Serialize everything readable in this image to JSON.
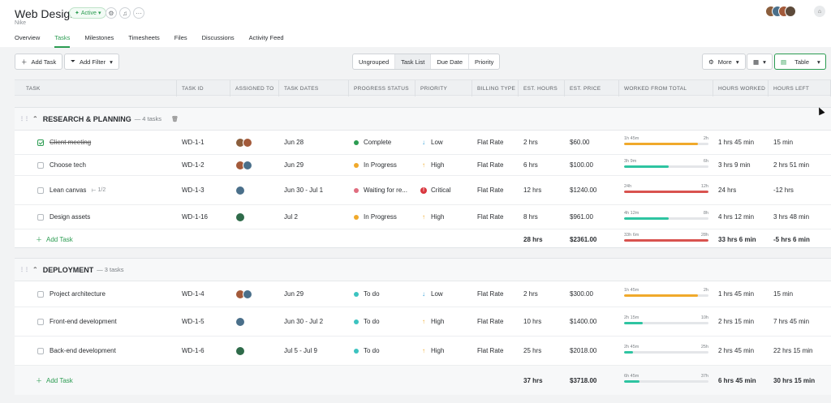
{
  "project": {
    "title": "Web Design",
    "subtitle": "Nike",
    "status": "Active",
    "status_icon": "sparkle-icon"
  },
  "tabs": [
    "Overview",
    "Tasks",
    "Milestones",
    "Timesheets",
    "Files",
    "Discussions",
    "Activity Feed"
  ],
  "active_tab": "Tasks",
  "toolbar": {
    "add_task": "Add Task",
    "add_filter": "Add Filter",
    "view_modes": [
      "Ungrouped",
      "Task List",
      "Due Date",
      "Priority"
    ],
    "selected_view_mode": "Task List",
    "more": "More",
    "view_type": "Table"
  },
  "columns": [
    "TASK",
    "TASK ID",
    "ASSIGNED TO",
    "TASK DATES",
    "PROGRESS STATUS",
    "PRIORITY",
    "BILLING TYPE",
    "EST. HOURS",
    "EST. PRICE",
    "WORKED FROM TOTAL",
    "HOURS WORKED",
    "HOURS LEFT"
  ],
  "colors": {
    "accent": "#2c9c52",
    "complete": "#2c9c52",
    "in_progress": "#f0a92b",
    "waiting": "#e06d7f",
    "todo": "#3cc3c0",
    "bar_teal": "#2ec4a1",
    "bar_orange": "#f0a92b",
    "bar_red": "#d9534f",
    "prio_low": "#2c9cd6",
    "prio_high": "#f0a92b",
    "prio_critical": "#d9363e"
  },
  "groups": [
    {
      "name": "RESEARCH & PLANNING",
      "count": "— 4 tasks",
      "tasks": [
        {
          "name": "Client meeting",
          "done": true,
          "id": "WD-1-1",
          "avatars": 2,
          "dates": "Jun 28",
          "status": "Complete",
          "status_color": "#2c9c52",
          "priority": "Low",
          "priority_icon": "↓",
          "priority_color": "#2c9cd6",
          "billing": "Flat Rate",
          "est_hours": "2 hrs",
          "est_price": "$60.00",
          "worked_label": "1h 45m",
          "total_label": "2h",
          "progress": 0.875,
          "bar_color": "#f0a92b",
          "hours_worked": "1 hrs 45 min",
          "hours_left": "15 min"
        },
        {
          "name": "Choose tech",
          "done": false,
          "id": "WD-1-2",
          "avatars": 2,
          "dates": "Jun 29",
          "status": "In Progress",
          "status_color": "#f0a92b",
          "priority": "High",
          "priority_icon": "↑",
          "priority_color": "#f0a92b",
          "billing": "Flat Rate",
          "est_hours": "6 hrs",
          "est_price": "$100.00",
          "worked_label": "3h 9m",
          "total_label": "6h",
          "progress": 0.525,
          "bar_color": "#2ec4a1",
          "hours_worked": "3 hrs 9 min",
          "hours_left": "2 hrs 51 min"
        },
        {
          "name": "Lean canvas",
          "subtasks": "1/2",
          "done": false,
          "id": "WD-1-3",
          "avatars": 1,
          "dates": "Jun 30 - Jul 1",
          "status": "Waiting for re...",
          "status_color": "#e06d7f",
          "priority": "Critical",
          "priority_icon": "!",
          "priority_color": "#d9363e",
          "billing": "Flat Rate",
          "est_hours": "12 hrs",
          "est_price": "$1240.00",
          "worked_label": "24h",
          "total_label": "12h",
          "progress": 1.0,
          "bar_color": "#d9534f",
          "hours_worked": "24 hrs",
          "hours_left": "-12 hrs"
        },
        {
          "name": "Design assets",
          "done": false,
          "id": "WD-1-16",
          "avatars": 1,
          "dates": "Jul 2",
          "status": "In Progress",
          "status_color": "#f0a92b",
          "priority": "High",
          "priority_icon": "↑",
          "priority_color": "#f0a92b",
          "billing": "Flat Rate",
          "est_hours": "8 hrs",
          "est_price": "$961.00",
          "worked_label": "4h 12m",
          "total_label": "8h",
          "progress": 0.525,
          "bar_color": "#2ec4a1",
          "hours_worked": "4 hrs 12 min",
          "hours_left": "3 hrs 48 min"
        }
      ],
      "add_task": "Add Task",
      "totals": {
        "est_hours": "28 hrs",
        "est_price": "$2361.00",
        "worked_label": "33h 6m",
        "total_label": "28h",
        "progress": 1.0,
        "bar_color": "#d9534f",
        "hours_worked": "33 hrs 6 min",
        "hours_left": "-5 hrs 6 min"
      }
    },
    {
      "name": "DEPLOYMENT",
      "count": "— 3 tasks",
      "tasks": [
        {
          "name": "Project architecture",
          "done": false,
          "id": "WD-1-4",
          "avatars": 2,
          "dates": "Jun 29",
          "status": "To do",
          "status_color": "#3cc3c0",
          "priority": "Low",
          "priority_icon": "↓",
          "priority_color": "#2c9cd6",
          "billing": "Flat Rate",
          "est_hours": "2 hrs",
          "est_price": "$300.00",
          "worked_label": "1h 45m",
          "total_label": "2h",
          "progress": 0.875,
          "bar_color": "#f0a92b",
          "hours_worked": "1 hrs 45 min",
          "hours_left": "15 min"
        },
        {
          "name": "Front-end development",
          "done": false,
          "id": "WD-1-5",
          "avatars": 1,
          "dates": "Jun 30 - Jul 2",
          "status": "To do",
          "status_color": "#3cc3c0",
          "priority": "High",
          "priority_icon": "↑",
          "priority_color": "#f0a92b",
          "billing": "Flat Rate",
          "est_hours": "10 hrs",
          "est_price": "$1400.00",
          "worked_label": "2h 15m",
          "total_label": "10h",
          "progress": 0.225,
          "bar_color": "#2ec4a1",
          "hours_worked": "2 hrs 15 min",
          "hours_left": "7 hrs 45 min"
        },
        {
          "name": "Back-end development",
          "done": false,
          "id": "WD-1-6",
          "avatars": 1,
          "dates": "Jul 5 - Jul 9",
          "status": "To do",
          "status_color": "#3cc3c0",
          "priority": "High",
          "priority_icon": "↑",
          "priority_color": "#f0a92b",
          "billing": "Flat Rate",
          "est_hours": "25 hrs",
          "est_price": "$2018.00",
          "worked_label": "2h 45m",
          "total_label": "25h",
          "progress": 0.11,
          "bar_color": "#2ec4a1",
          "hours_worked": "2 hrs 45 min",
          "hours_left": "22 hrs 15 min"
        }
      ],
      "add_task": "Add Task",
      "totals": {
        "est_hours": "37 hrs",
        "est_price": "$3718.00",
        "worked_label": "6h 45m",
        "total_label": "37h",
        "progress": 0.18,
        "bar_color": "#2ec4a1",
        "hours_worked": "6 hrs 45 min",
        "hours_left": "30 hrs 15 min"
      }
    }
  ]
}
